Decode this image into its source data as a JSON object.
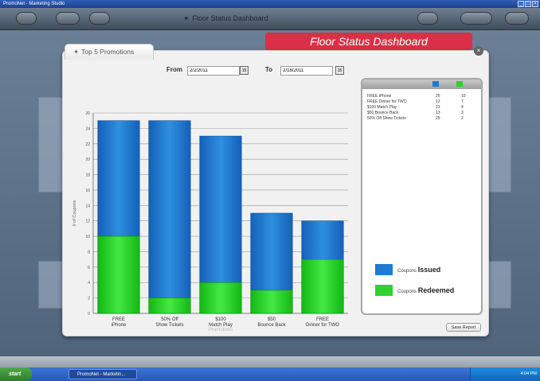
{
  "window": {
    "title": "PromoNet - Marketing Studio",
    "controls": [
      "_",
      "□",
      "×"
    ]
  },
  "appbar": {
    "center_title": "Floor Status Dashboard"
  },
  "banner": {
    "text": "Floor Status Dashboard",
    "color": "#d93047"
  },
  "panel": {
    "tab_label": "Top 5 Promotions",
    "close_label": "×",
    "from_label": "From",
    "from_value": "2/2/2011",
    "to_label": "To",
    "to_value": "2/18/2011",
    "calendar_label": "15",
    "save_label": "Save Report"
  },
  "legend": {
    "rows": [
      {
        "name": "FREE iPhone",
        "issued": "25",
        "redeemed": "10"
      },
      {
        "name": "FREE Dinner for TWO",
        "issued": "12",
        "redeemed": "7"
      },
      {
        "name": "$100 Match Play",
        "issued": "23",
        "redeemed": "4"
      },
      {
        "name": "$50 Bounce Back",
        "issued": "13",
        "redeemed": "3"
      },
      {
        "name": "50% Off Show Tickets",
        "issued": "25",
        "redeemed": "2"
      }
    ],
    "issued_small": "Coupons",
    "issued_big": "Issued",
    "redeemed_small": "Coupons",
    "redeemed_big": "Redeemed",
    "issued_color": "#1f7ad0",
    "redeemed_color": "#2fd12f"
  },
  "chart_data": {
    "type": "bar",
    "categories": [
      "FREE iPhone",
      "50% Off Show Tickets",
      "$100 Match Play",
      "$50 Bounce Back",
      "FREE Dinner for TWO"
    ],
    "category_line1": [
      "FREE",
      "50% Off",
      "$100",
      "$50",
      "FREE"
    ],
    "category_line2": [
      "iPhone",
      "Show Tickets",
      "Match Play",
      "Bounce Back",
      "Dinner for TWO"
    ],
    "series": [
      {
        "name": "Coupons Issued",
        "values": [
          25,
          25,
          23,
          13,
          12
        ]
      },
      {
        "name": "Coupons Redeemed",
        "values": [
          10,
          2,
          4,
          3,
          7
        ]
      }
    ],
    "xlabel": "Promotions",
    "ylabel": "# of Coupons",
    "ylim": [
      0,
      26
    ],
    "yticks": [
      0,
      2,
      4,
      6,
      8,
      10,
      12,
      14,
      16,
      18,
      20,
      22,
      24,
      26
    ],
    "grid": true
  },
  "taskbar": {
    "start_label": "start",
    "task_label": "PromoNet - Marketin...",
    "clock": "4:04 PM"
  }
}
